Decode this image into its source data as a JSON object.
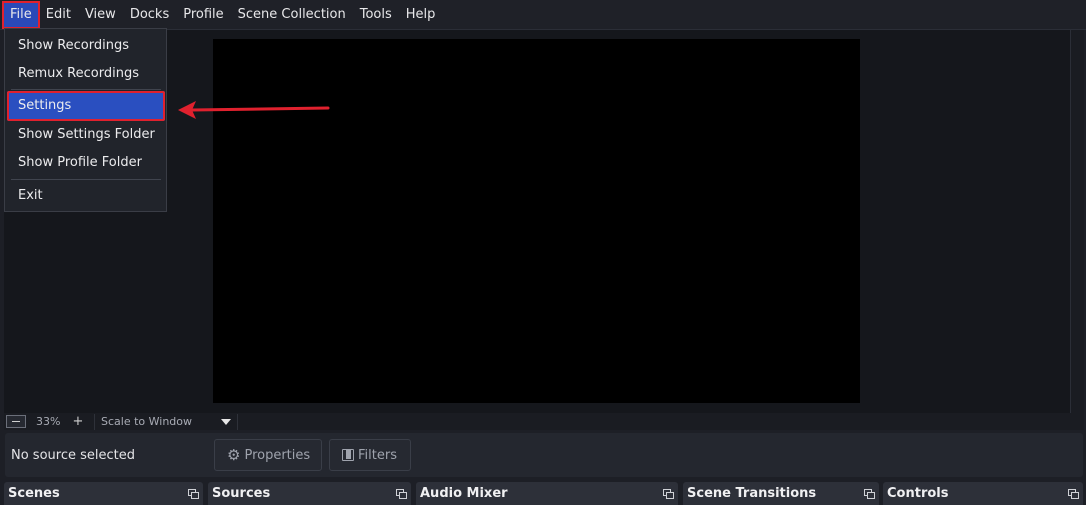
{
  "menubar": {
    "items": [
      {
        "label": "File"
      },
      {
        "label": "Edit"
      },
      {
        "label": "View"
      },
      {
        "label": "Docks"
      },
      {
        "label": "Profile"
      },
      {
        "label": "Scene Collection"
      },
      {
        "label": "Tools"
      },
      {
        "label": "Help"
      }
    ]
  },
  "file_menu": {
    "items": [
      {
        "label": "Show Recordings"
      },
      {
        "label": "Remux Recordings"
      },
      {
        "label": "Settings"
      },
      {
        "label": "Show Settings Folder"
      },
      {
        "label": "Show Profile Folder"
      },
      {
        "label": "Exit"
      }
    ]
  },
  "zoom": {
    "level": "33%",
    "plus_glyph": "+",
    "scale_mode": "Scale to Window"
  },
  "source_toolbar": {
    "status": "No source selected",
    "properties_label": "Properties",
    "filters_label": "Filters"
  },
  "docks": [
    {
      "title": "Scenes"
    },
    {
      "title": "Sources"
    },
    {
      "title": "Audio Mixer"
    },
    {
      "title": "Scene Transitions"
    },
    {
      "title": "Controls"
    }
  ],
  "colors": {
    "accent": "#2a4fc0",
    "annotation": "#e0212e"
  }
}
